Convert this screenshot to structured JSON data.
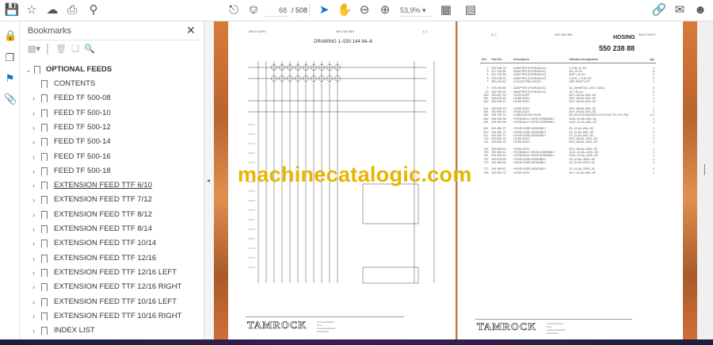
{
  "toolbar": {
    "page_current": "68",
    "page_total": "/ 508",
    "zoom": "53,9%"
  },
  "colors": {
    "accent": "#1a6fc9",
    "watermark": "#e8b400",
    "background_orange": "#c8743c"
  },
  "bookmarks": {
    "title": "Bookmarks",
    "root": "OPTIONAL FEEDS",
    "items": [
      "CONTENTS",
      "FEED TF 500-08",
      "FEED TF 500-10",
      "FEED TF 500-12",
      "FEED TF 500-14",
      "FEED TF 500-16",
      "FEED TF 500-18",
      "EXTENSION FEED TTF 6/10",
      "EXTENSION FEED TTF 7/12",
      "EXTENSION FEED TTF 8/12",
      "EXTENSION FEED TTF 8/14",
      "EXTENSION FEED TTF 10/14",
      "EXTENSION FEED TTF 12/16",
      "EXTENSION FEED TTF 12/16 LEFT",
      "EXTENSION FEED TTF 12/16 RIGHT",
      "EXTENSION FEED TTF 10/16 LEFT",
      "EXTENSION FEED TTF 10/16 RIGHT",
      "INDEX LIST"
    ]
  },
  "left_page": {
    "header_left": "0604 DWPV",
    "header_mid": "550 238 88H",
    "header_right": "1/ 2",
    "drawing_title": "DRAWING 1–550 144 64–K",
    "brand": "TAMROCK"
  },
  "right_page": {
    "header_left": "2/ 2",
    "header_mid": "550 238 88K",
    "header_right": "0604 DWPV",
    "title": "HOSING",
    "number": "550 238 88",
    "brand": "TAMROCK",
    "columns": [
      "Ref",
      "Part No.",
      "Description",
      "Standard designation",
      "Qty"
    ],
    "groups": [
      [
        [
          "2",
          "550 398 78",
          "ADAPTER (HYDRAULIC)",
          "1.1/16–12 JIC",
          "4"
        ],
        [
          "3",
          "517 164 55",
          "ADAPTER (HYDRAULIC)",
          "3/4–16 JIC",
          "6"
        ],
        [
          "4",
          "517 134 55",
          "ADAPTER (HYDRAULIC)",
          "9/16\"–18 JIC",
          "2"
        ],
        [
          "6",
          "578 298 00",
          "ADAPTER (HYDRAULIC)",
          "1.5/16–1.1/16 JIC",
          "2"
        ],
        [
          "7",
          "550 143 80",
          "COLLECTING PIECE",
          "SEP. PART LIST",
          "1"
        ]
      ],
      [
        [
          "9",
          "578 398 88",
          "ADAPTER (HYDRAULIC)",
          "12–10HMTX(1.1/16–7.5JIC)",
          "2"
        ],
        [
          "10",
          "518 782 45",
          "ADAPTER (HYDRAULIC)",
          "JIC 7/8–14",
          "2"
        ],
        [
          "530",
          "590 847 45",
          "HOSE ASSY",
          "5/4T–08 AA–600–JIC",
          "1"
        ],
        [
          "531",
          "590 878 45",
          "HOSE ASSY",
          "5/4T–08 AA–620–JIC",
          "1"
        ],
        [
          "540",
          "590 895 19",
          "HOSE ASSY",
          "5/4T–08 AA–620–JIC",
          "1"
        ]
      ],
      [
        [
          "541",
          "590 895 19",
          "HOSE ASSY",
          "5/4T–08 AA–600–JIC",
          "1"
        ],
        [
          "544",
          "590 895 19",
          "HOSE ASSY",
          "5/4T–08 AA–600–JIC",
          "1"
        ],
        [
          "551",
          "596 782 79",
          "LUBRICATION HOSE",
          "PA–6/4 POLSAN B6T24 P12 R40 TR–P11 P40",
          "2.4"
        ],
        [
          "660",
          "591 593 96",
          "HYDRAULIC HOSE ASSEMBLY",
          "2410–10 AA–600–JIC",
          "1"
        ],
        [
          "661",
          "591 593 96",
          "HYDRAULIC HOSE ASSEMBLY",
          "2410–10 AA–600–JIC",
          "1"
        ]
      ],
      [
        [
          "667",
          "591 681 70",
          "HYDR.HOSE ASSEMBLY",
          "23–12 AA–600–JIC",
          "1"
        ],
        [
          "670",
          "591 681 70",
          "HYDR.HOSE ASSEMBLY",
          "23–12 AA–600–JIC",
          "1"
        ],
        [
          "671",
          "591 681 70",
          "HYDR.HOSE ASSEMBLY",
          "23–12 AA–600–JIC",
          "1"
        ],
        [
          "740",
          "590 854 76",
          "HOSE ASSY",
          "5/4T–08 AA–1000–JIC",
          "1"
        ],
        [
          "741",
          "590 854 76",
          "HOSE ASSY",
          "5/4T–08 AA–1000–JIC",
          "1"
        ]
      ],
      [
        [
          "744",
          "590 862 50",
          "HOSE ASSY",
          "5/4T–08 AA–2000–JIC",
          "1"
        ],
        [
          "750",
          "591 695 14",
          "HYDRAULIC HOSE ASSEMBLY",
          "2410–10 AA–2420–JIC",
          "1"
        ],
        [
          "751",
          "591 695 14",
          "HYDRAULIC HOSE ASSEMBLY",
          "2410–10 AA–2420–JIC",
          "1"
        ],
        [
          "757",
          "590 678 65",
          "HYDR.HOSE ASSEMBLY",
          "23–12 AA–2500–JIC",
          "1"
        ],
        [
          "770",
          "591 695 69",
          "HYDR.HOSE ASSEMBLY",
          "23–12 AA–2070–JIC",
          "1"
        ]
      ],
      [
        [
          "771",
          "591 695 62",
          "HYDR.HOSE ASSEMBLY",
          "23–12 AA–2030–JIC",
          "1"
        ],
        [
          "799",
          "526 352 75",
          "HOSE ASSY",
          "9/17–12 AA–800–JIC",
          "1"
        ]
      ]
    ]
  },
  "watermark": "machinecatalogic.com"
}
